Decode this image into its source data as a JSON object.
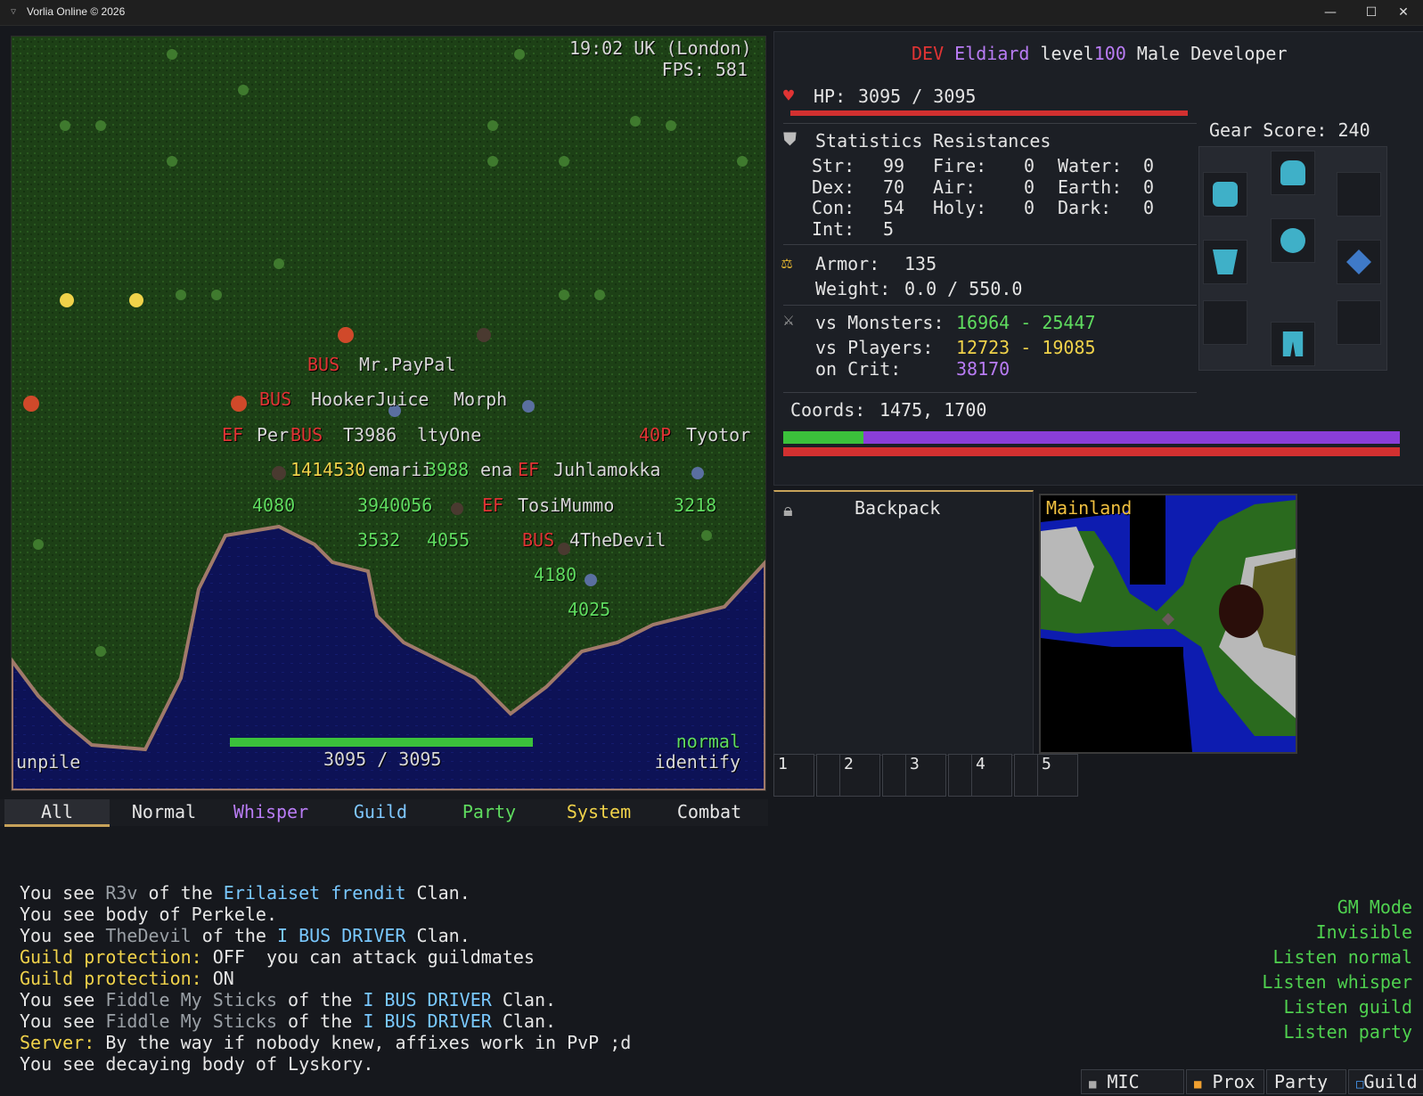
{
  "window": {
    "title": "Vorlia Online © 2026",
    "icon": "app-icon"
  },
  "hud": {
    "clock": "19:02 UK (London)",
    "fps": "FPS: 581",
    "bottom_left": "unpile",
    "hp_text": "3095 / 3095",
    "hp_fraction": 1.0,
    "mode_line1": "normal",
    "mode_line2": "identify"
  },
  "world_labels": [
    {
      "text": "BUS",
      "c": "red",
      "pos": "a1"
    },
    {
      "text": "Mr.PayPal",
      "c": "white",
      "pos": "a2"
    },
    {
      "text": "BUS",
      "c": "red",
      "pos": "b1"
    },
    {
      "text": "HookerJuice",
      "c": "white",
      "pos": "b2"
    },
    {
      "text": "Morph",
      "c": "white",
      "pos": "b3"
    },
    {
      "text": "EF",
      "c": "red",
      "pos": "c1"
    },
    {
      "text": "Per",
      "c": "white",
      "pos": "c2"
    },
    {
      "text": "BUS",
      "c": "red",
      "pos": "c3"
    },
    {
      "text": "T3986",
      "c": "white",
      "pos": "c4"
    },
    {
      "text": "ltyOne",
      "c": "white",
      "pos": "c5"
    },
    {
      "text": "40P",
      "c": "red",
      "pos": "c6"
    },
    {
      "text": "Tyotor",
      "c": "white",
      "pos": "c7"
    },
    {
      "text": "1414530",
      "c": "yellow",
      "pos": "d1"
    },
    {
      "text": "emarii",
      "c": "white",
      "pos": "d2"
    },
    {
      "text": "3988",
      "c": "green",
      "pos": "d3"
    },
    {
      "text": "ena",
      "c": "white",
      "pos": "d4"
    },
    {
      "text": "EF",
      "c": "red",
      "pos": "d5"
    },
    {
      "text": "Juhlamokka",
      "c": "white",
      "pos": "d6"
    },
    {
      "text": "4080",
      "c": "green",
      "pos": "e1"
    },
    {
      "text": "3940056",
      "c": "green",
      "pos": "e2"
    },
    {
      "text": "EF",
      "c": "red",
      "pos": "e3"
    },
    {
      "text": "TosiMummo",
      "c": "white",
      "pos": "e4"
    },
    {
      "text": "3218",
      "c": "green",
      "pos": "e5"
    },
    {
      "text": "3532",
      "c": "green",
      "pos": "f1"
    },
    {
      "text": "4055",
      "c": "green",
      "pos": "f2"
    },
    {
      "text": "BUS",
      "c": "red",
      "pos": "f3"
    },
    {
      "text": "4TheDevil",
      "c": "white",
      "pos": "f4"
    },
    {
      "text": "4180",
      "c": "green",
      "pos": "g1"
    },
    {
      "text": "4025",
      "c": "green",
      "pos": "h1"
    }
  ],
  "character": {
    "tag": "DEV",
    "name": "Eldiard",
    "level_label": "level",
    "level": "100",
    "desc": "Male Developer",
    "hp_label": "HP:",
    "hp": "3095 / 3095",
    "hp_fraction": 1.0,
    "statistics_label": "Statistics",
    "resistances_label": "Resistances",
    "stats": [
      {
        "k": "Str:",
        "v": "99"
      },
      {
        "k": "Dex:",
        "v": "70"
      },
      {
        "k": "Con:",
        "v": "54"
      },
      {
        "k": "Int:",
        "v": "5"
      }
    ],
    "res_col1": [
      {
        "k": "Fire:",
        "v": "0"
      },
      {
        "k": "Air:",
        "v": "0"
      },
      {
        "k": "Holy:",
        "v": "0"
      }
    ],
    "res_col2": [
      {
        "k": "Water:",
        "v": "0"
      },
      {
        "k": "Earth:",
        "v": "0"
      },
      {
        "k": "Dark:",
        "v": "0"
      }
    ],
    "armor_label": "Armor:",
    "armor": "135",
    "weight_label": "Weight:",
    "weight": "0.0 / 550.0",
    "vs_monsters_label": "vs Monsters:",
    "vs_monsters": "16964 - 25447",
    "vs_players_label": "vs Players:",
    "vs_players": "12723 - 19085",
    "on_crit_label": "on Crit:",
    "on_crit": "38170",
    "coords_label": "Coords:",
    "coords": "1475, 1700",
    "gear_score": "Gear Score: 240",
    "mana_fraction": 1.0,
    "stamina_fraction": 0.13
  },
  "backpack": {
    "title": "Backpack"
  },
  "minimap": {
    "label": "Mainland"
  },
  "hotbar": [
    "1",
    "2",
    "3",
    "4",
    "5"
  ],
  "chat_tabs": [
    {
      "label": "All",
      "color": "#e6e6e6"
    },
    {
      "label": "Normal",
      "color": "#e6e6e6"
    },
    {
      "label": "Whisper",
      "color": "#b97cf5"
    },
    {
      "label": "Guild",
      "color": "#7fc7ff"
    },
    {
      "label": "Party",
      "color": "#5fdc5f"
    },
    {
      "label": "System",
      "color": "#f0d24a"
    },
    {
      "label": "Combat",
      "color": "#e6e6e6"
    }
  ],
  "chat_lines": [
    [
      {
        "t": "You see ",
        "c": ""
      },
      {
        "t": "R3v",
        "c": "gray"
      },
      {
        "t": " of the ",
        "c": ""
      },
      {
        "t": "Erilaiset frendit",
        "c": "cyan"
      },
      {
        "t": " Clan.",
        "c": ""
      }
    ],
    [
      {
        "t": "You see body of Perkele.",
        "c": ""
      }
    ],
    [
      {
        "t": "You see ",
        "c": ""
      },
      {
        "t": "TheDevil",
        "c": "gray"
      },
      {
        "t": " of the ",
        "c": ""
      },
      {
        "t": "I BUS DRIVER",
        "c": "cyan"
      },
      {
        "t": " Clan.",
        "c": ""
      }
    ],
    [
      {
        "t": "Guild protection:",
        "c": "y"
      },
      {
        "t": " OFF  you can attack guildmates",
        "c": ""
      }
    ],
    [
      {
        "t": "Guild protection:",
        "c": "y"
      },
      {
        "t": " ON",
        "c": ""
      }
    ],
    [
      {
        "t": "You see ",
        "c": ""
      },
      {
        "t": "Fiddle My Sticks",
        "c": "gray"
      },
      {
        "t": " of the ",
        "c": ""
      },
      {
        "t": "I BUS DRIVER",
        "c": "cyan"
      },
      {
        "t": " Clan.",
        "c": ""
      }
    ],
    [
      {
        "t": "You see ",
        "c": ""
      },
      {
        "t": "Fiddle My Sticks",
        "c": "gray"
      },
      {
        "t": " of the ",
        "c": ""
      },
      {
        "t": "I BUS DRIVER",
        "c": "cyan"
      },
      {
        "t": " Clan.",
        "c": ""
      }
    ],
    [
      {
        "t": "Server:",
        "c": "y"
      },
      {
        "t": " By the way if nobody knew, affixes work in PvP ;d",
        "c": ""
      }
    ],
    [
      {
        "t": "You see decaying body of Lyskory.",
        "c": ""
      }
    ]
  ],
  "gm_flags": [
    "GM Mode",
    "Invisible",
    "Listen normal",
    "Listen whisper",
    "Listen guild",
    "Listen party"
  ],
  "voice": [
    {
      "label": "MIC",
      "dot": "#aaaaaa"
    },
    {
      "label": "Prox",
      "dot": "#f0a030"
    },
    {
      "label": "Party",
      "dot": ""
    },
    {
      "label": "Guild",
      "dot": "#4aa0ff"
    }
  ],
  "colors": {
    "accent_red": "#e03434",
    "accent_green": "#5fdc5f",
    "accent_purple": "#9b4fe0"
  }
}
